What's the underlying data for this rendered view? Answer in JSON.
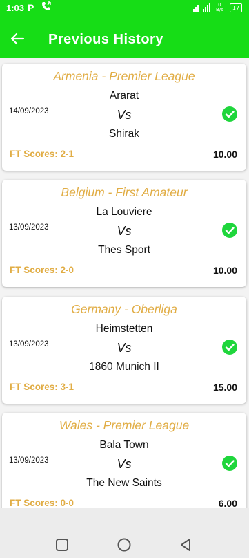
{
  "status_bar": {
    "time": "1:03",
    "p_label": "P",
    "speed_value": "0",
    "speed_unit": "B/s",
    "battery": "17"
  },
  "header": {
    "title": "Previous History"
  },
  "matches": [
    {
      "league": "Armenia - Premier League",
      "home": "Ararat",
      "vs": "Vs",
      "away": "Shirak",
      "date": "14/09/2023",
      "ft_label": "FT Scores:  2-1",
      "odds": "10.00"
    },
    {
      "league": "Belgium - First Amateur",
      "home": "La Louviere",
      "vs": "Vs",
      "away": "Thes Sport",
      "date": "13/09/2023",
      "ft_label": "FT Scores:  2-0",
      "odds": "10.00"
    },
    {
      "league": "Germany - Oberliga",
      "home": "Heimstetten",
      "vs": "Vs",
      "away": "1860 Munich II",
      "date": "13/09/2023",
      "ft_label": "FT Scores:  3-1",
      "odds": "15.00"
    },
    {
      "league": "Wales - Premier League",
      "home": "Bala Town",
      "vs": "Vs",
      "away": "The New Saints",
      "date": "13/09/2023",
      "ft_label": "FT Scores:  0-0",
      "odds": "6.00"
    }
  ],
  "colors": {
    "header_bg": "#16dd16",
    "league_text": "#e1ad45",
    "check_green": "#1fd63c"
  },
  "icons": {
    "back": "arrow-left-icon",
    "check": "check-circle-icon",
    "nav": [
      "square-icon",
      "circle-icon",
      "triangle-back-icon"
    ]
  }
}
